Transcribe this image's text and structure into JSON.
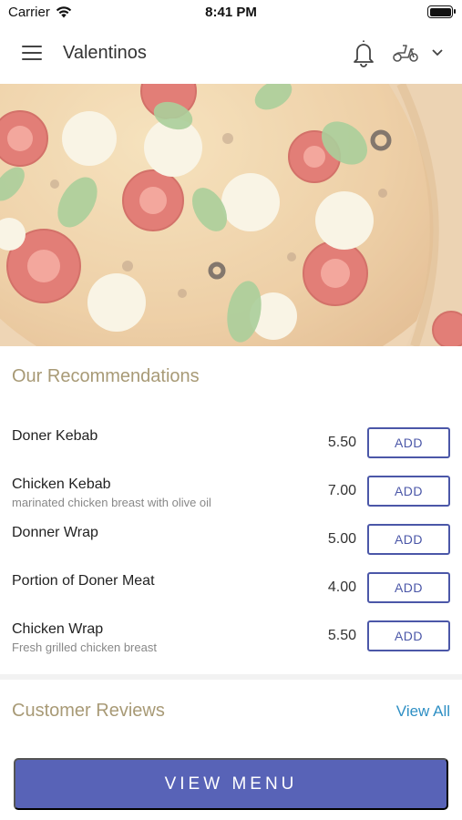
{
  "status_bar": {
    "carrier": "Carrier",
    "time": "8:41 PM"
  },
  "navbar": {
    "title": "Valentinos",
    "icons": [
      "menu-icon",
      "bell-icon",
      "scooter-icon",
      "chevron-down-icon"
    ]
  },
  "hero": {
    "image": "pizza-image"
  },
  "recommendations": {
    "title": "Our Recommendations",
    "items": [
      {
        "name": "Doner Kebab",
        "description": "",
        "price": "5.50",
        "button": "ADD"
      },
      {
        "name": "Chicken Kebab",
        "description": "marinated chicken breast with olive oil",
        "price": "7.00",
        "button": "ADD"
      },
      {
        "name": "Donner Wrap",
        "description": "",
        "price": "5.00",
        "button": "ADD"
      },
      {
        "name": "Portion of Doner Meat",
        "description": "",
        "price": "4.00",
        "button": "ADD"
      },
      {
        "name": "Chicken Wrap",
        "description": "Fresh grilled chicken breast",
        "price": "5.50",
        "button": "ADD"
      }
    ]
  },
  "reviews": {
    "title": "Customer Reviews",
    "view_all": "View All"
  },
  "footer": {
    "view_menu": "VIEW MENU"
  },
  "colors": {
    "accent": "#5863b7",
    "section_title": "#a89a76",
    "link": "#2e8fc4"
  }
}
